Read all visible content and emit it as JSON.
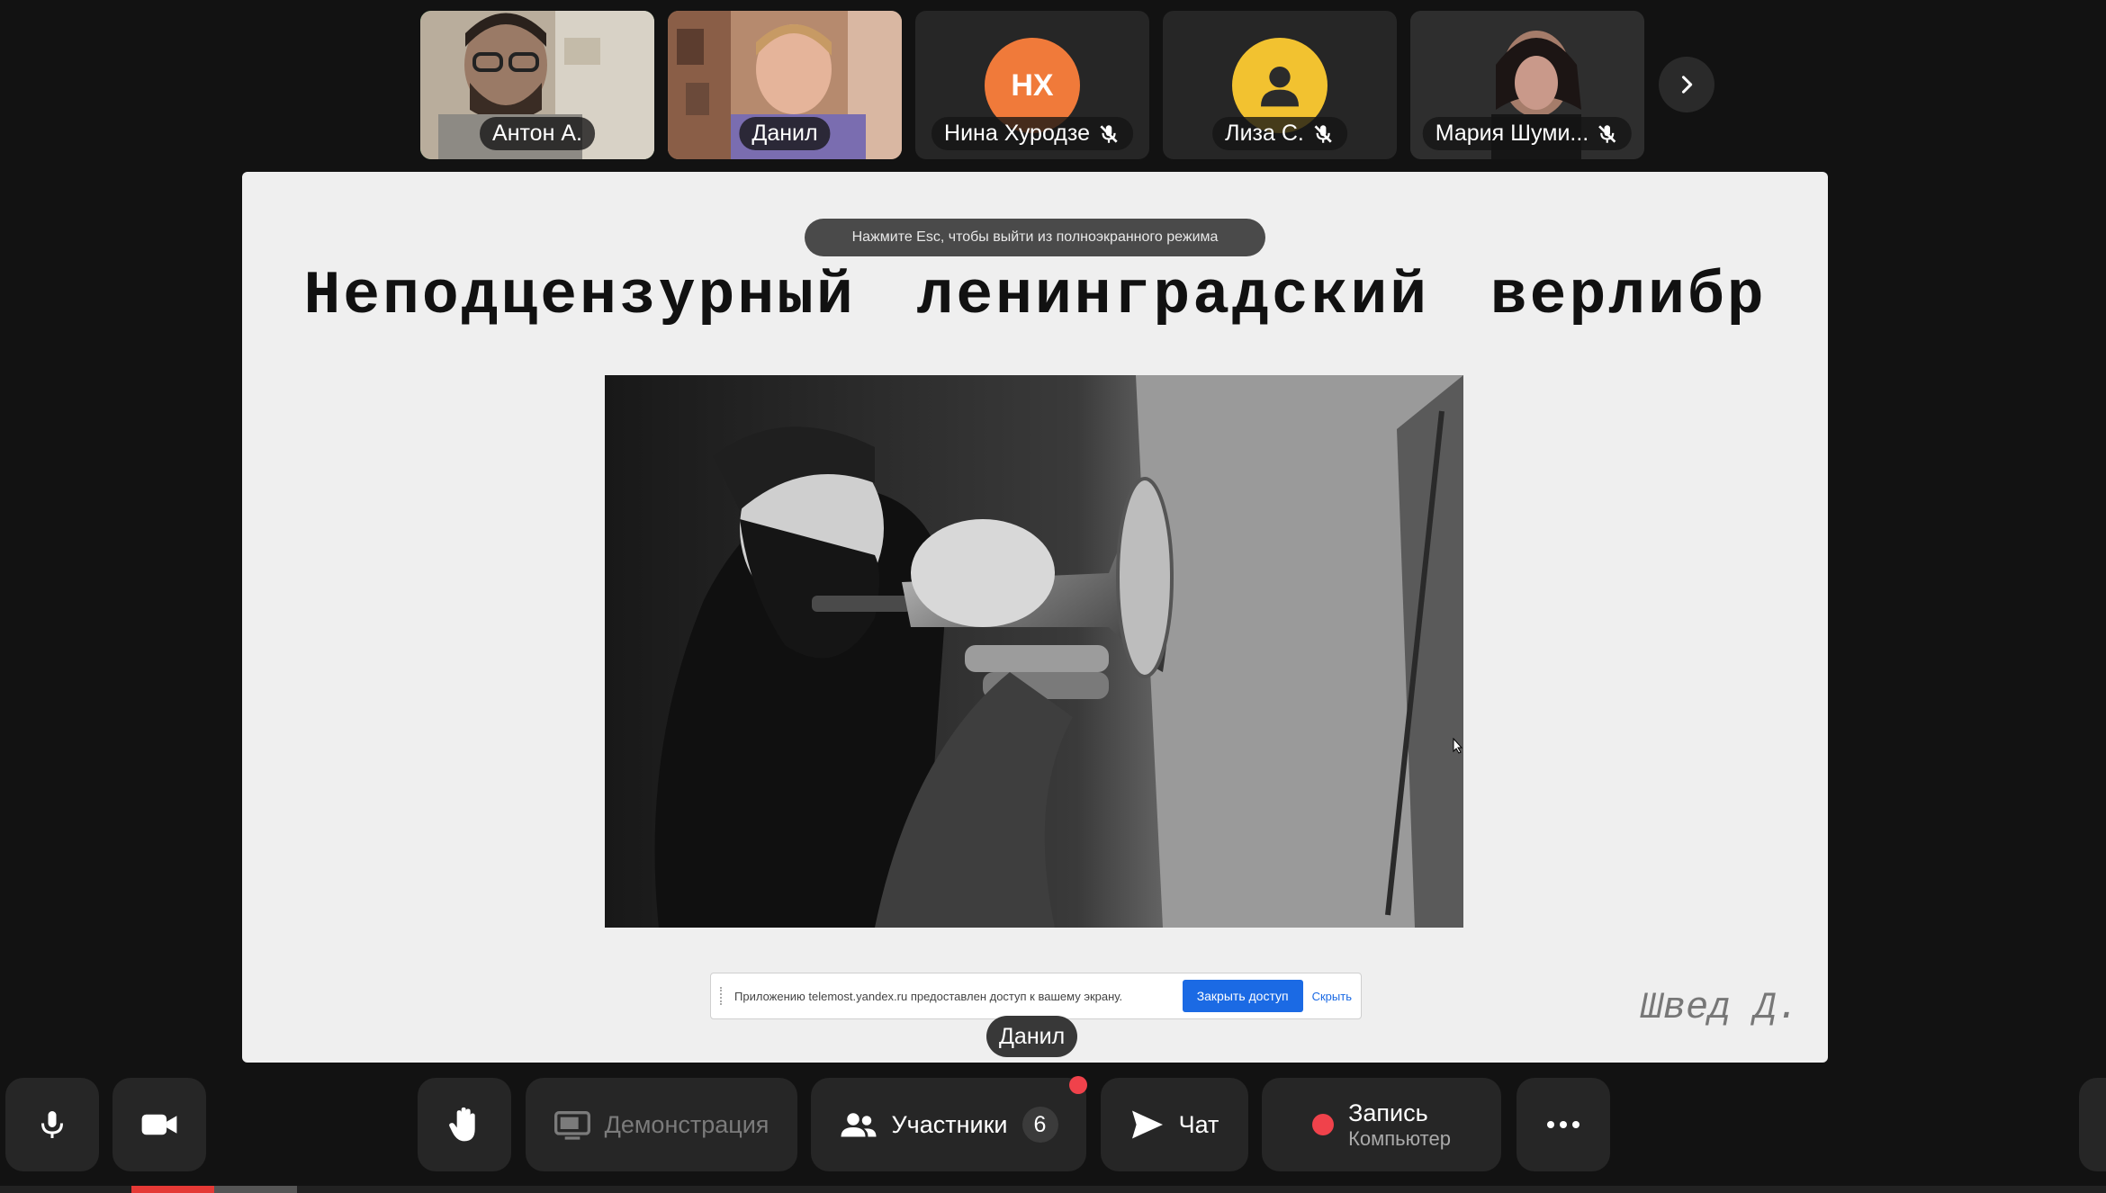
{
  "participants": [
    {
      "name": "Антон А.",
      "active": true,
      "muted": false,
      "type": "video"
    },
    {
      "name": "Данил",
      "active": false,
      "muted": false,
      "type": "video"
    },
    {
      "name": "Нина Хуродзе",
      "initials": "НХ",
      "muted": true,
      "type": "initials",
      "color": "#f07a3a"
    },
    {
      "name": "Лиза С.",
      "muted": true,
      "type": "placeholder",
      "color": "#f2c230"
    },
    {
      "name": "Мария Шуми...",
      "muted": true,
      "type": "video"
    }
  ],
  "screen": {
    "esc_hint": "Нажмите Esc, чтобы выйти из полноэкранного режима",
    "slide_title": "Неподцензурный ленинградский верлибр",
    "author": "Швед Д.",
    "share_bar": {
      "message": "Приложению telemost.yandex.ru предоставлен доступ к вашему экрану.",
      "stop_label": "Закрыть доступ",
      "hide_label": "Скрыть"
    },
    "presenter": "Данил"
  },
  "toolbar": {
    "demo_label": "Демонстрация",
    "participants_label": "Участники",
    "participants_count": "6",
    "chat_label": "Чат",
    "record_label": "Запись",
    "record_sub": "Компьютер"
  },
  "colors": {
    "accent": "#3ddc68",
    "stop_button": "#1b6ae4",
    "record": "#f0424b"
  }
}
